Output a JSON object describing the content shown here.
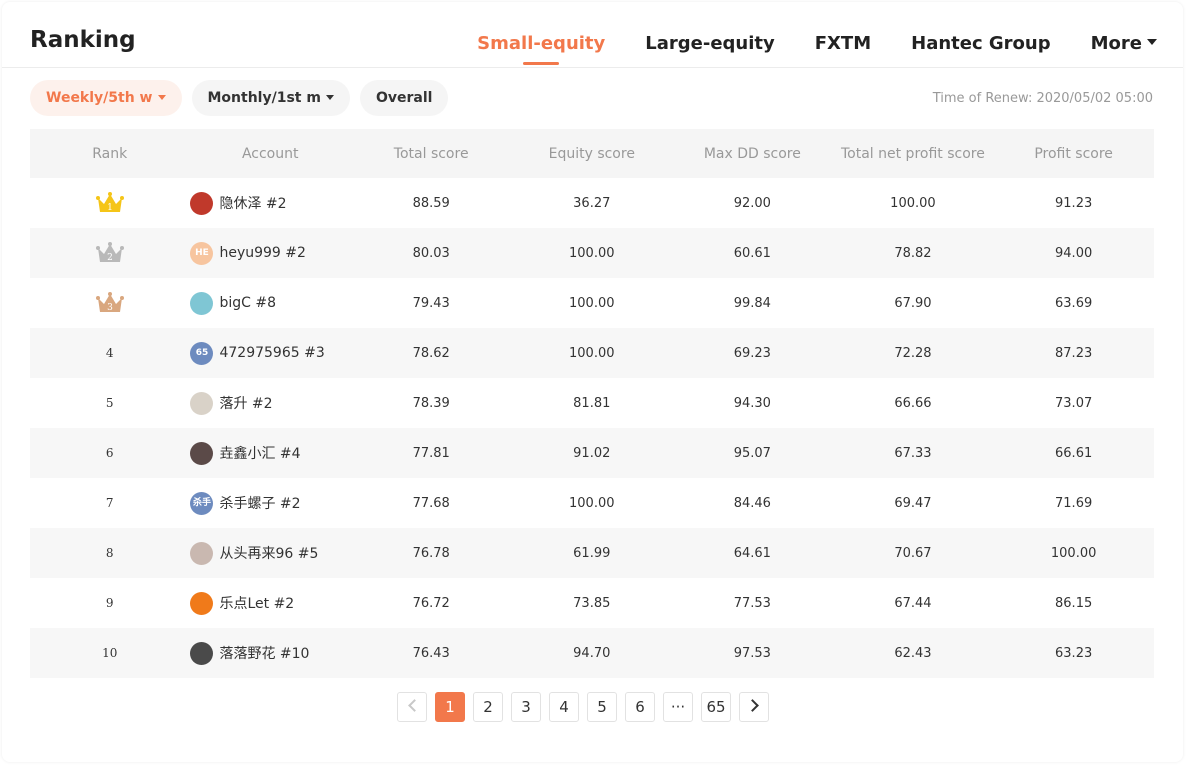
{
  "header": {
    "title": "Ranking",
    "tabs": [
      {
        "label": "Small-equity",
        "active": true
      },
      {
        "label": "Large-equity",
        "active": false
      },
      {
        "label": "FXTM",
        "active": false
      },
      {
        "label": "Hantec Group",
        "active": false
      },
      {
        "label": "More",
        "active": false
      }
    ]
  },
  "filters": {
    "weekly": "Weekly/5th w",
    "monthly": "Monthly/1st m",
    "overall": "Overall"
  },
  "renew_time": "Time of Renew: 2020/05/02 05:00",
  "table": {
    "columns": [
      "Rank",
      "Account",
      "Total score",
      "Equity score",
      "Max DD score",
      "Total net profit score",
      "Profit score"
    ],
    "rows": [
      {
        "rank": "1",
        "crown": "gold",
        "avatar_icon": "avatar-photo-icon",
        "avatar_color": "#c0392b",
        "avatar_text": "",
        "account": "隐休泽 #2",
        "total": "88.59",
        "equity": "36.27",
        "maxdd": "92.00",
        "netprofit": "100.00",
        "profit": "91.23"
      },
      {
        "rank": "2",
        "crown": "silver",
        "avatar_icon": "avatar-initials-icon",
        "avatar_color": "#f7c59f",
        "avatar_text": "HE",
        "account": "heyu999 #2",
        "total": "80.03",
        "equity": "100.00",
        "maxdd": "60.61",
        "netprofit": "78.82",
        "profit": "94.00"
      },
      {
        "rank": "3",
        "crown": "bronze",
        "avatar_icon": "avatar-photo-icon",
        "avatar_color": "#7fc6d4",
        "avatar_text": "",
        "account": "bigC #8",
        "total": "79.43",
        "equity": "100.00",
        "maxdd": "99.84",
        "netprofit": "67.90",
        "profit": "63.69"
      },
      {
        "rank": "4",
        "crown": "",
        "avatar_icon": "avatar-initials-icon",
        "avatar_color": "#6d8bbf",
        "avatar_text": "65",
        "account": "472975965 #3",
        "total": "78.62",
        "equity": "100.00",
        "maxdd": "69.23",
        "netprofit": "72.28",
        "profit": "87.23"
      },
      {
        "rank": "5",
        "crown": "",
        "avatar_icon": "avatar-photo-icon",
        "avatar_color": "#d9d2c8",
        "avatar_text": "",
        "account": "落升 #2",
        "total": "78.39",
        "equity": "81.81",
        "maxdd": "94.30",
        "netprofit": "66.66",
        "profit": "73.07"
      },
      {
        "rank": "6",
        "crown": "",
        "avatar_icon": "avatar-photo-icon",
        "avatar_color": "#5b4a48",
        "avatar_text": "",
        "account": "垚鑫小汇 #4",
        "total": "77.81",
        "equity": "91.02",
        "maxdd": "95.07",
        "netprofit": "67.33",
        "profit": "66.61"
      },
      {
        "rank": "7",
        "crown": "",
        "avatar_icon": "avatar-initials-icon",
        "avatar_color": "#6d8bbf",
        "avatar_text": "杀手",
        "account": "杀手螺子 #2",
        "total": "77.68",
        "equity": "100.00",
        "maxdd": "84.46",
        "netprofit": "69.47",
        "profit": "71.69"
      },
      {
        "rank": "8",
        "crown": "",
        "avatar_icon": "avatar-photo-icon",
        "avatar_color": "#c9b8b0",
        "avatar_text": "",
        "account": "从头再来96 #5",
        "total": "76.78",
        "equity": "61.99",
        "maxdd": "64.61",
        "netprofit": "70.67",
        "profit": "100.00"
      },
      {
        "rank": "9",
        "crown": "",
        "avatar_icon": "avatar-logo-icon",
        "avatar_color": "#f07a1a",
        "avatar_text": "",
        "account": "乐点Let #2",
        "total": "76.72",
        "equity": "73.85",
        "maxdd": "77.53",
        "netprofit": "67.44",
        "profit": "86.15"
      },
      {
        "rank": "10",
        "crown": "",
        "avatar_icon": "avatar-photo-icon",
        "avatar_color": "#4a4a4a",
        "avatar_text": "",
        "account": "落落野花 #10",
        "total": "76.43",
        "equity": "94.70",
        "maxdd": "97.53",
        "netprofit": "62.43",
        "profit": "63.23"
      }
    ]
  },
  "pagination": {
    "pages": [
      "1",
      "2",
      "3",
      "4",
      "5",
      "6",
      "···",
      "65"
    ],
    "current": "1",
    "prev_icon": "chevron-left-icon",
    "next_icon": "chevron-right-icon"
  },
  "colors": {
    "accent": "#f2784b",
    "gold": "#f5c518",
    "silver": "#b9b9b9",
    "bronze": "#d9a77f"
  }
}
